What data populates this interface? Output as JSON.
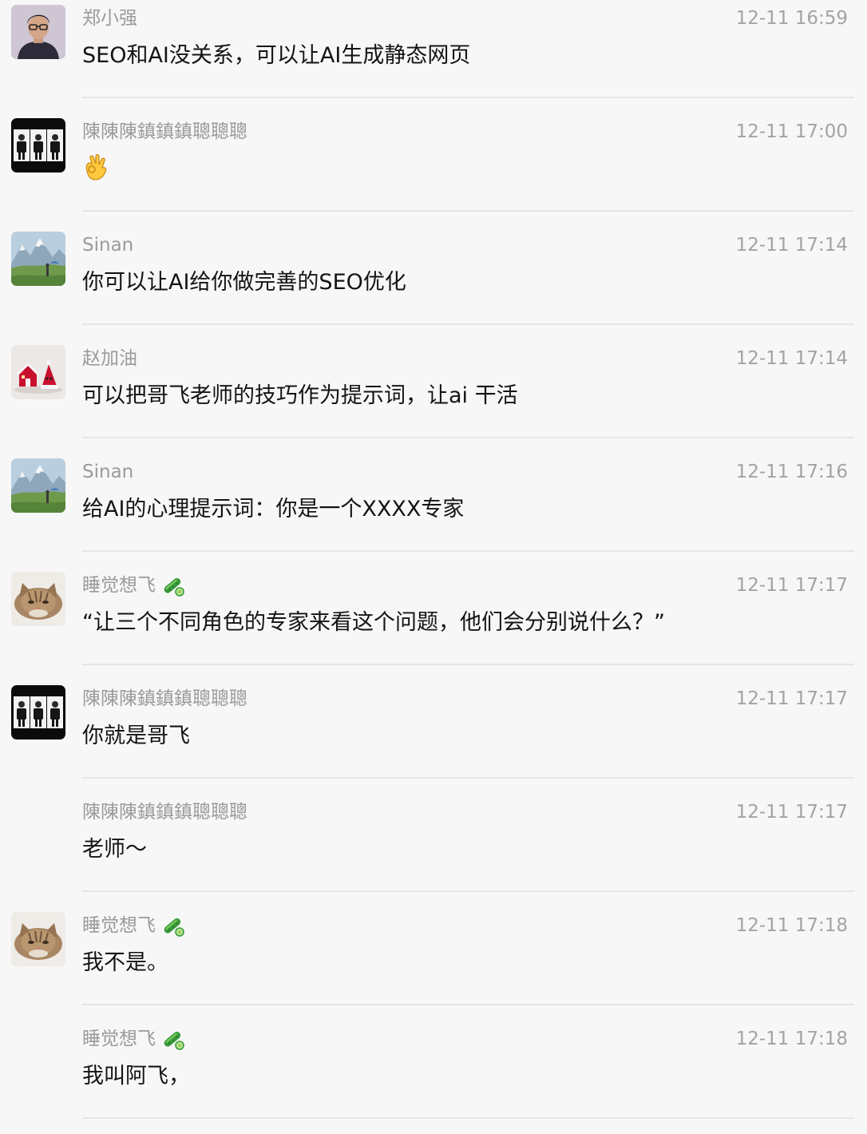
{
  "messages": [
    {
      "sender": "郑小强",
      "time": "12-11 16:59",
      "text": "SEO和AI没关系，可以让AI生成静态网页",
      "avatar": "portrait-glasses",
      "name_emoji": null,
      "content_icon": null
    },
    {
      "sender": "陳陳陳鎮鎮鎮聰聰聰",
      "time": "12-11 17:00",
      "text": "",
      "avatar": "three-people-photo",
      "name_emoji": null,
      "content_icon": "ok-hand-emoji"
    },
    {
      "sender": "Sinan",
      "time": "12-11 17:14",
      "text": "你可以让AI给你做完善的SEO优化",
      "avatar": "mountain-landscape",
      "name_emoji": null,
      "content_icon": null
    },
    {
      "sender": "赵加油",
      "time": "12-11 17:14",
      "text": "可以把哥飞老师的技巧作为提示词，让ai 干活",
      "avatar": "christmas-figurines",
      "name_emoji": null,
      "content_icon": null
    },
    {
      "sender": "Sinan",
      "time": "12-11 17:16",
      "text": "给AI的心理提示词：你是一个XXXX专家",
      "avatar": "mountain-landscape",
      "name_emoji": null,
      "content_icon": null
    },
    {
      "sender": "睡觉想飞",
      "time": "12-11 17:17",
      "text": "“让三个不同角色的专家来看这个问题，他们会分别说什么？”",
      "avatar": "cat-face",
      "name_emoji": "cucumber-emoji",
      "content_icon": null
    },
    {
      "sender": "陳陳陳鎮鎮鎮聰聰聰",
      "time": "12-11 17:17",
      "text": "你就是哥飞",
      "avatar": "three-people-photo",
      "name_emoji": null,
      "content_icon": null
    },
    {
      "sender": "陳陳陳鎮鎮鎮聰聰聰",
      "time": "12-11 17:17",
      "text": "老师～",
      "avatar": null,
      "name_emoji": null,
      "content_icon": null
    },
    {
      "sender": "睡觉想飞",
      "time": "12-11 17:18",
      "text": "我不是。",
      "avatar": "cat-face",
      "name_emoji": "cucumber-emoji",
      "content_icon": null
    },
    {
      "sender": "睡觉想飞",
      "time": "12-11 17:18",
      "text": "我叫阿飞，",
      "avatar": null,
      "name_emoji": "cucumber-emoji",
      "content_icon": null
    }
  ],
  "colors": {
    "background": "#f7f7f7",
    "sender_name": "#9a9a9a",
    "timestamp": "#a3a3a3",
    "message_text": "#141414",
    "divider": "#e6e6e6"
  }
}
